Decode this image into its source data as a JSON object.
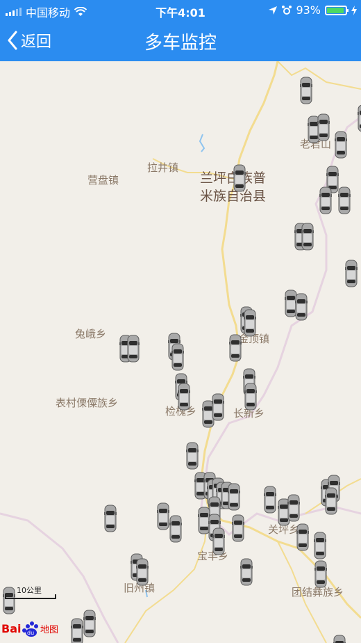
{
  "status": {
    "carrier": "中国移动",
    "time": "下午4:01",
    "battery": "93%",
    "battery_level": 0.93
  },
  "nav": {
    "back_label": "返回",
    "title": "多车监控"
  },
  "map": {
    "labels": [
      {
        "id": "label-yingpan",
        "text": "营盘镇"
      },
      {
        "id": "label-lajing",
        "text": "拉井镇"
      },
      {
        "id": "label-lanping",
        "text": "兰坪白族普米族自治县"
      },
      {
        "id": "label-laojun",
        "text": "老君山"
      },
      {
        "id": "label-tue",
        "text": "兔峨乡"
      },
      {
        "id": "label-biaocun",
        "text": "表村傈僳族乡"
      },
      {
        "id": "label-jianhuai",
        "text": "检槐乡"
      },
      {
        "id": "label-changxin",
        "text": "长新乡"
      },
      {
        "id": "label-jinding",
        "text": "金顶镇"
      },
      {
        "id": "label-baofeng",
        "text": "宝丰乡"
      },
      {
        "id": "label-jiuzhou",
        "text": "旧州镇"
      },
      {
        "id": "label-tuanjie",
        "text": "团结彝族乡"
      },
      {
        "id": "label-guanping",
        "text": "关坪乡"
      }
    ],
    "scale_label": "10公里",
    "brand": "Baidu地图"
  },
  "colors": {
    "accent": "#2b8cf0",
    "map_bg": "#f2efe9",
    "road": "#f6df98",
    "boundary": "#d8c8d8"
  }
}
